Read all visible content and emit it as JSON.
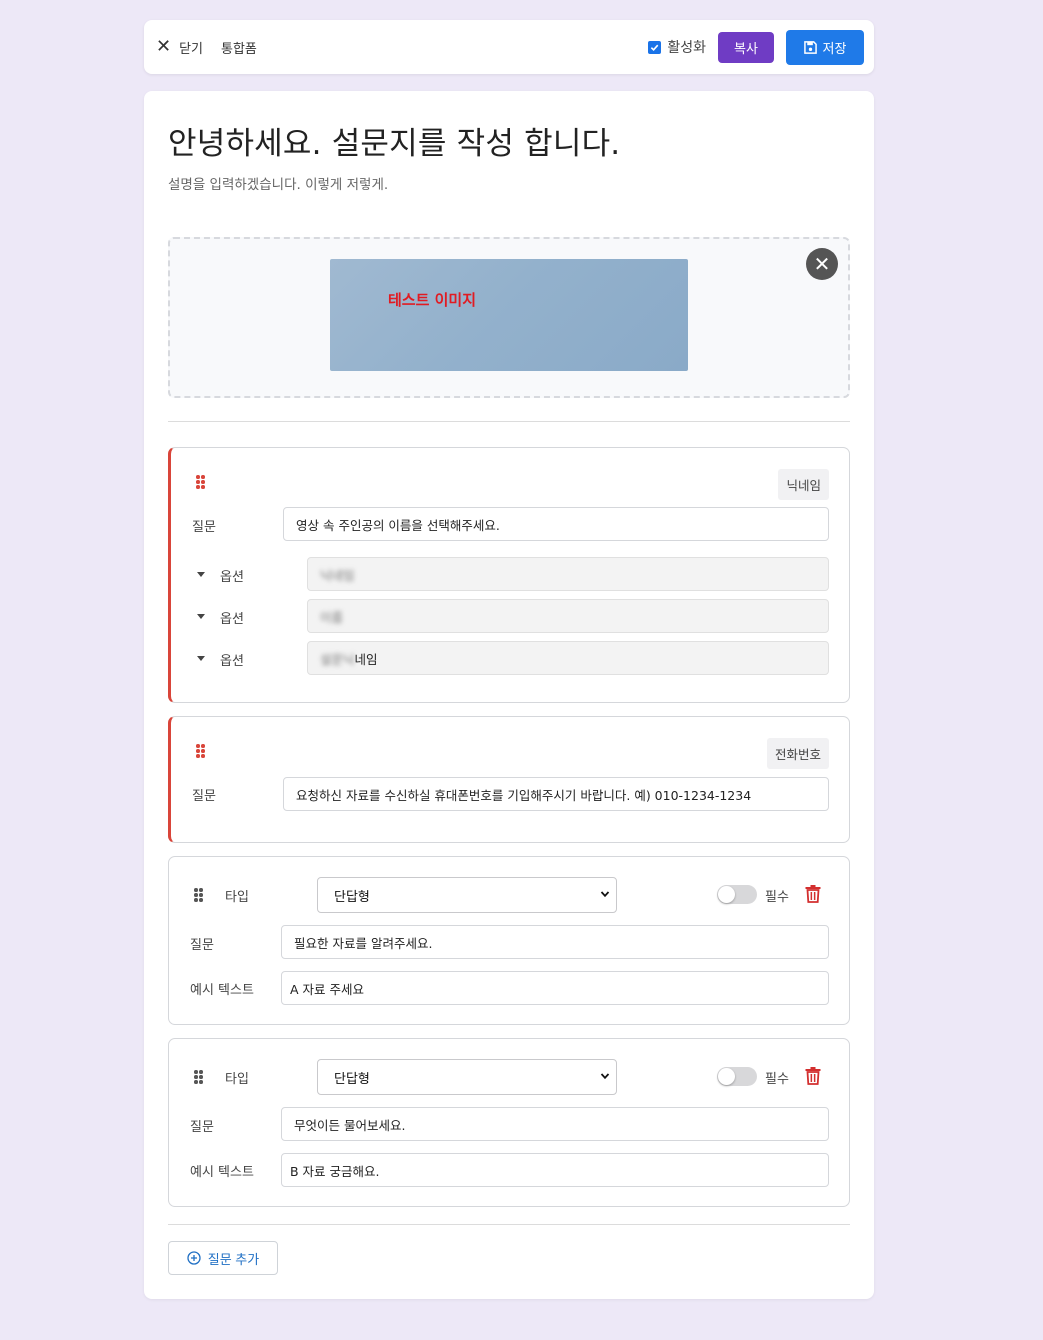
{
  "topbar": {
    "close_label": "닫기",
    "form_name": "통합폼",
    "active_label": "활성화",
    "active_checked": true,
    "copy_label": "복사",
    "save_label": "저장"
  },
  "form": {
    "title": "안녕하세요. 설문지를 작성 합니다.",
    "description": "설명을 입력하겠습니다. 이렇게 저렇게.",
    "image_text": "테스트 이미지"
  },
  "questions": [
    {
      "badge": "닉네임",
      "question_label": "질문",
      "question": "영상 속 주인공의 이름을 선택해주세요.",
      "option_label": "옵션",
      "options": [
        {
          "blurred": "닉네임",
          "visible": ""
        },
        {
          "blurred": "이름",
          "visible": ""
        },
        {
          "blurred": "설문닉",
          "visible": "네임"
        }
      ]
    },
    {
      "badge": "전화번호",
      "question_label": "질문",
      "question": "요청하신 자료를 수신하실 휴대폰번호를 기입해주시기 바랍니다. 예) 010-1234-1234"
    },
    {
      "type_label": "타입",
      "type_value": "단답형",
      "required_label": "필수",
      "required": false,
      "question_label": "질문",
      "question": "필요한 자료를 알려주세요.",
      "example_label": "예시 텍스트",
      "example": "A 자료 주세요"
    },
    {
      "type_label": "타입",
      "type_value": "단답형",
      "required_label": "필수",
      "required": false,
      "question_label": "질문",
      "question": "무엇이든 물어보세요.",
      "example_label": "예시 텍스트",
      "example": "B 자료 궁금해요."
    }
  ],
  "add_question_label": "질문 추가",
  "colors": {
    "background": "#ede8f7",
    "copy_button": "#6f3cc4",
    "save_button": "#1f7ae8",
    "fixed_accent": "#d9453a",
    "delete_icon": "#d32f2f",
    "link": "#1f6fc4"
  }
}
